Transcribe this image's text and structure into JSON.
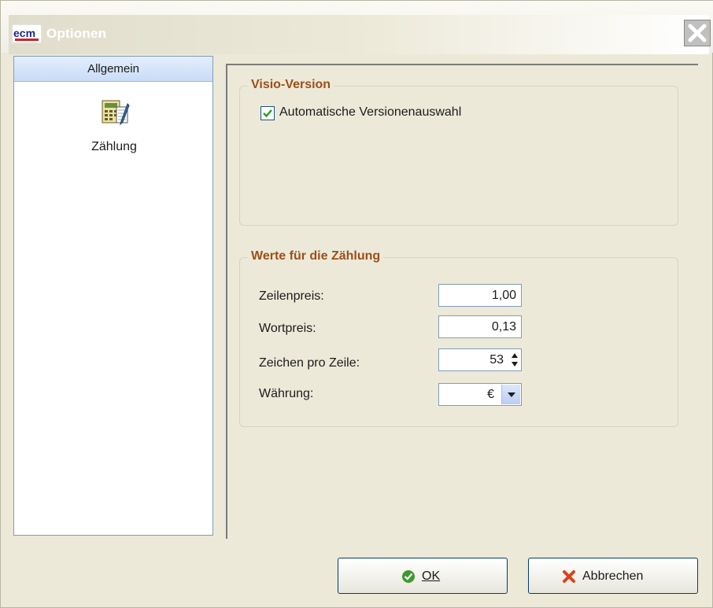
{
  "window": {
    "title": "Optionen",
    "logo_text": "ecm",
    "close_icon": "close-icon"
  },
  "sidebar": {
    "header": "Allgemein",
    "items": [
      {
        "label": "Zählung",
        "icon": "calculator-document-icon"
      }
    ]
  },
  "visio_group": {
    "title": "Visio-Version",
    "auto_version_label": "Automatische Versionenauswahl",
    "auto_version_checked": true
  },
  "count_group": {
    "title": "Werte für die Zählung",
    "line_price_label": "Zeilenpreis:",
    "line_price_value": "1,00",
    "word_price_label": "Wortpreis:",
    "word_price_value": "0,13",
    "chars_per_line_label": "Zeichen pro Zeile:",
    "chars_per_line_value": "53",
    "currency_label": "Währung:",
    "currency_value": "€"
  },
  "buttons": {
    "ok_label": "OK",
    "cancel_label": "Abbrechen"
  },
  "colors": {
    "group_title": "#9c4f1a",
    "accent_border": "#003c74",
    "nav_header_bg": "#c9dcf6"
  }
}
